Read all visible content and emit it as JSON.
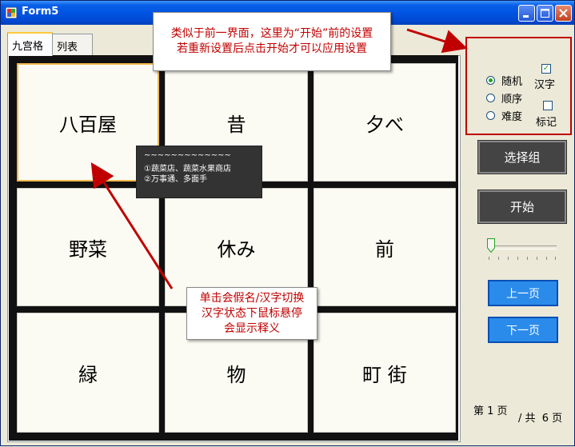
{
  "window": {
    "title": "Form5"
  },
  "tabs": [
    {
      "label": "九宫格",
      "active": true
    },
    {
      "label": "列表",
      "active": false
    }
  ],
  "grid": {
    "cells": [
      "八百屋",
      "昔",
      "夕べ",
      "野菜",
      "休み",
      "前",
      "緑",
      "物",
      "町 街"
    ],
    "selected_index": 0
  },
  "tooltip": {
    "title": "~~~~~~~~~~~~~",
    "line1": "①蔬菜店、蔬菜水果商店",
    "line2": "②万事通、多面手"
  },
  "callouts": {
    "top": {
      "line1": "类似于前一界面，这里为“开始”前的设置",
      "line2": "若重新设置后点击开始才可以应用设置"
    },
    "bottom": {
      "line1": "单击会假名/汉字切换",
      "line2": "汉字状态下鼠标悬停",
      "line3": "会显示释义"
    }
  },
  "options": {
    "random": "随机",
    "sequential": "顺序",
    "difficulty": "难度",
    "selected": "random",
    "kanji": "汉字",
    "kanji_checked": true,
    "mark": "标记",
    "mark_checked": false
  },
  "buttons": {
    "select_group": "选择组",
    "start": "开始",
    "prev": "上一页",
    "next": "下一页"
  },
  "slider": {
    "value": 0
  },
  "pager": {
    "current": "第 1 页",
    "total": "/ 共  6 页"
  },
  "colors": {
    "annotation": "#C00000",
    "accent_button": "#2A8BEA",
    "dark_button": "#444444",
    "titlebar": "#0054E3"
  }
}
